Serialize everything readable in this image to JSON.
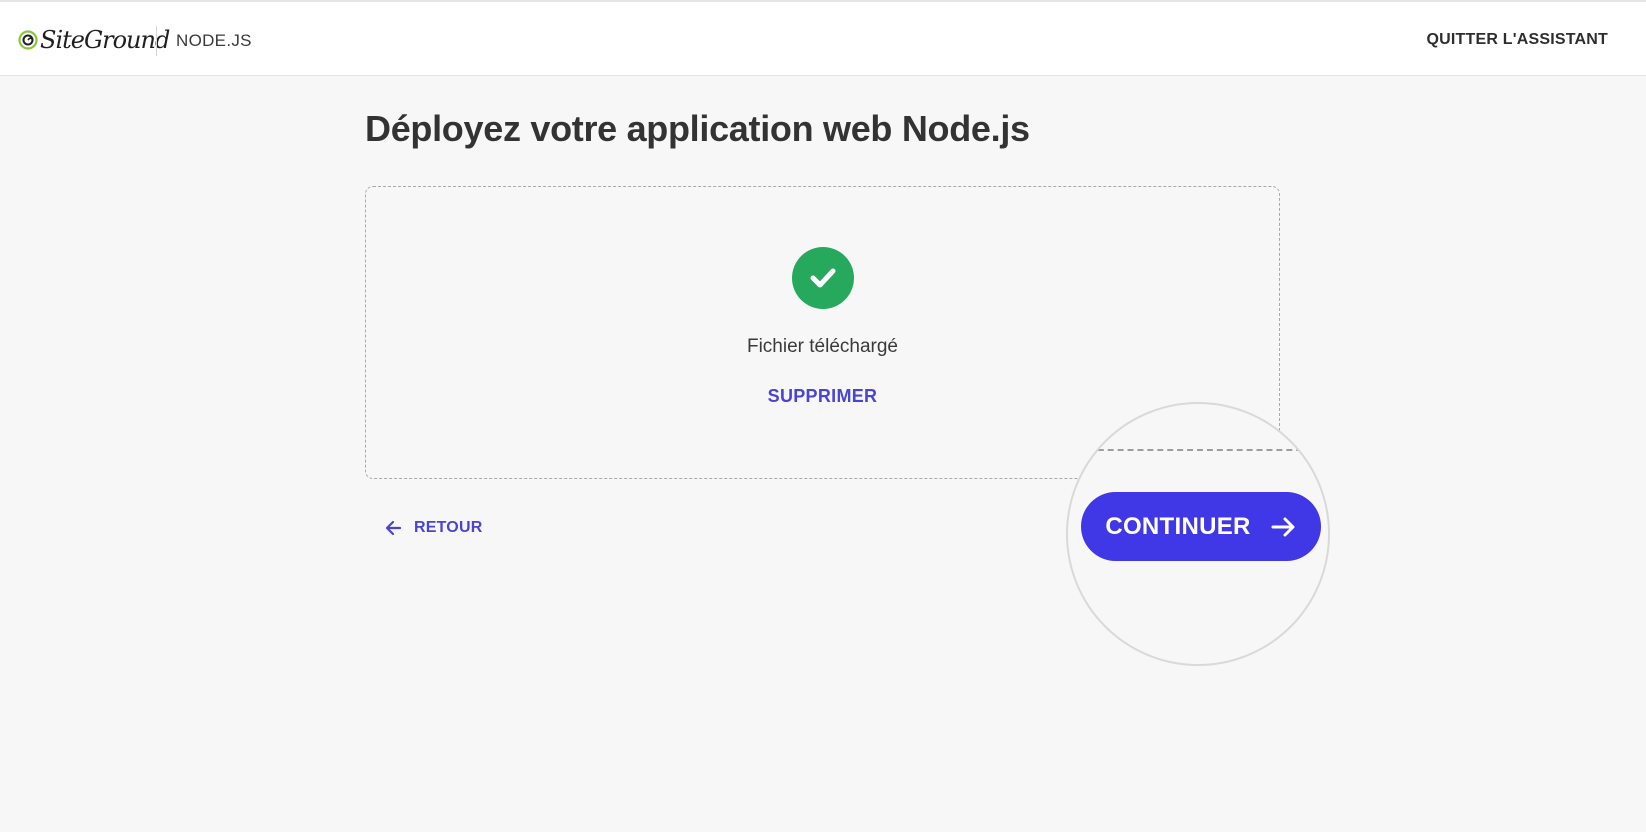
{
  "header": {
    "logo_text": "SiteGround",
    "app_name": "NODE.JS",
    "quit_label": "QUITTER L'ASSISTANT"
  },
  "main": {
    "title": "Déployez votre application web Node.js",
    "upload": {
      "status_text": "Fichier téléchargé",
      "remove_label": "SUPPRIMER"
    },
    "nav": {
      "back_label": "RETOUR",
      "continue_label": "CONTINUER"
    }
  },
  "colors": {
    "accent": "#4038e6",
    "link": "#4a44d4",
    "success": "#26a95c",
    "logo_green": "#8cc63f"
  },
  "icons": {
    "success": "check-circle-icon",
    "back": "arrow-left-icon",
    "continue": "arrow-right-icon"
  }
}
